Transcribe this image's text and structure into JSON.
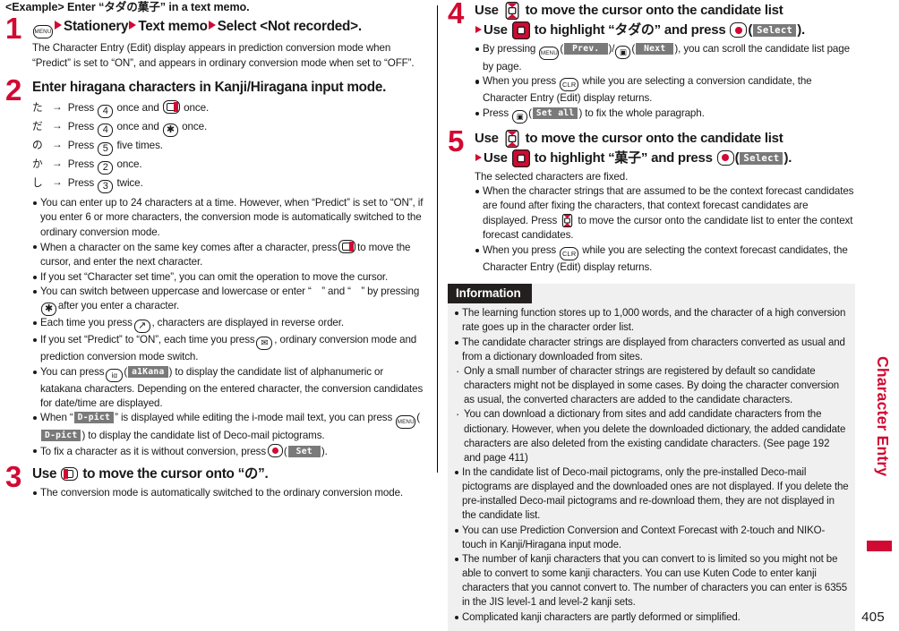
{
  "page_number": "405",
  "thumb_tab": {
    "label": "Character Entry"
  },
  "example_heading": "<Example> Enter “タダの菓子” in a text memo.",
  "keys": {
    "menu": "MENU",
    "clr": "CLR",
    "num4": "4",
    "num5": "5",
    "num2": "2",
    "num3": "3",
    "star": "✳",
    "call": "↗",
    "mail": "✉",
    "ialpha": "iα",
    "camera": "■"
  },
  "softkeys": {
    "select": "Select",
    "set": "Set",
    "set_all": "Set all",
    "prev": "Prev.",
    "next": "Next",
    "dpict": "D-pict",
    "a1kana": "a1Kana"
  },
  "steps": [
    {
      "num": "1",
      "head_parts": [
        "Stationery",
        "Text memo",
        "Select <Not recorded>."
      ],
      "sub": "The Character Entry (Edit) display appears in prediction conversion mode when “Predict” is set to “ON”, and appears in ordinary conversion mode when set to “OFF”."
    },
    {
      "num": "2",
      "head": "Enter hiragana characters in Kanji/Hiragana input mode.",
      "kv_rows": [
        {
          "kana": "た",
          "pre": "Press",
          "mid": "once and",
          "post": "once."
        },
        {
          "kana": "だ",
          "pre": "Press",
          "mid": "once and",
          "post": "once."
        },
        {
          "kana": "の",
          "pre": "Press",
          "post": "five times."
        },
        {
          "kana": "か",
          "pre": "Press",
          "post": "once."
        },
        {
          "kana": "し",
          "pre": "Press",
          "post": "twice."
        }
      ],
      "bullets": [
        "You can enter up to 24 characters at a time. However, when “Predict” is set to “ON”, if you enter 6 or more characters, the conversion mode is automatically switched to the ordinary conversion mode.",
        "When a character on the same key comes after a character, press  to move the cursor, and enter the next character.",
        "If you set “Character set time”, you can omit the operation to move the cursor.",
        "You can switch between uppercase and lowercase or enter “　” and “　” by pressing  after you enter a character.",
        "Each time you press  , characters are displayed in reverse order.",
        "If you set “Predict” to “ON”, each time you press  , ordinary conversion mode and prediction conversion mode switch.",
        "You can press  to display the candidate list of alphanumeric or katakana characters. Depending on the entered character, the conversion candidates for date/time are displayed.",
        "When “ ” is displayed while editing the i-mode mail text, you can press  to display the candidate list of Deco-mail pictograms.",
        "To fix a character as it is without conversion, press  ."
      ]
    },
    {
      "num": "3",
      "head_a": "Use",
      "head_b": "to move the cursor onto “の”.",
      "bullet": "The conversion mode is automatically switched to the ordinary conversion mode."
    },
    {
      "num": "4",
      "head_line1_a": "Use",
      "head_line1_b": "to move the cursor onto the candidate list",
      "head_line2_a": "Use",
      "head_line2_b": "to highlight “タダの” and press",
      "head_line2_c": ").",
      "bullets": [
        "By pressing  ), you can scroll the candidate list page by page.",
        "When you press  while you are selecting a conversion candidate, the Character Entry (Edit) display returns.",
        "Press  ) to fix the whole paragraph."
      ]
    },
    {
      "num": "5",
      "head_line1_a": "Use",
      "head_line1_b": "to move the cursor onto the candidate list",
      "head_line2_a": "Use",
      "head_line2_b": "to highlight “菓子” and press",
      "head_line2_c": ").",
      "sub": "The selected characters are fixed.",
      "bullets": [
        "When the character strings that are assumed to be the context forecast candidates are found after fixing the characters, that context forecast candidates are displayed. Press  to move the cursor onto the candidate list to enter the context forecast candidates.",
        "When you press  while you are selecting the context forecast candidates, the Character Entry (Edit) display returns."
      ]
    }
  ],
  "information": {
    "title": "Information",
    "items": [
      {
        "type": "bullet",
        "text": "The learning function stores up to 1,000 words, and the character of a high conversion rate goes up in the character order list."
      },
      {
        "type": "bullet",
        "text": "The candidate character strings are displayed from characters converted as usual and from a dictionary downloaded from sites."
      },
      {
        "type": "dot",
        "text": "Only a small number of character strings are registered by default so candidate characters might not be displayed in some cases. By doing the character conversion as usual, the converted characters are added to the candidate characters."
      },
      {
        "type": "dot",
        "text": "You can download a dictionary from sites and add candidate characters from the dictionary. However, when you delete the downloaded dictionary, the added candidate characters are also deleted from the existing candidate characters. (See page 192 and page 411)"
      },
      {
        "type": "bullet",
        "text": "In the candidate list of Deco-mail pictograms, only the pre-installed Deco-mail pictograms are displayed and the downloaded ones are not displayed. If you delete the pre-installed Deco-mail pictograms and re-download them, they are not displayed in the candidate list."
      },
      {
        "type": "bullet",
        "text": "You can use Prediction Conversion and Context Forecast with 2-touch and NIKO-touch in Kanji/Hiragana input mode."
      },
      {
        "type": "bullet",
        "text": "The number of kanji characters that you can convert to is limited so you might not be able to convert to some kanji characters. You can use Kuten Code to enter kanji characters that you cannot convert to. The number of characters you can enter is 6355 in the JIS level-1 and level-2 kanji sets."
      },
      {
        "type": "bullet",
        "text": "Complicated kanji characters are partly deformed or simplified."
      }
    ]
  },
  "colors": {
    "accent_red": "#d10a33",
    "info_bg": "#f0f0f0",
    "info_header_bg": "#231f1f",
    "softkey_bg": "#7a7a7a"
  }
}
